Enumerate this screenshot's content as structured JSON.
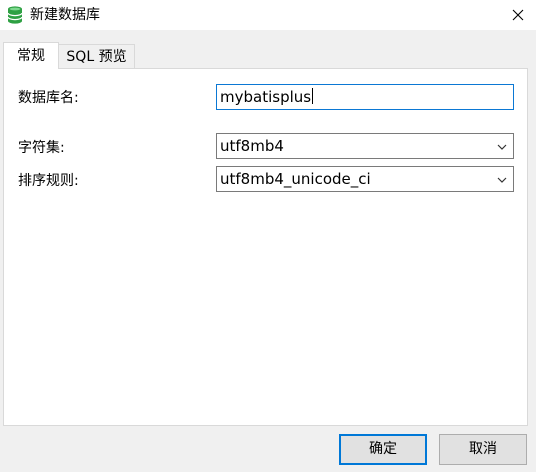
{
  "window": {
    "title": "新建数据库",
    "icon": "database-icon",
    "close_icon": "close-icon"
  },
  "tabs": [
    {
      "label": "常规",
      "active": true
    },
    {
      "label": "SQL 预览",
      "active": false
    }
  ],
  "form": {
    "db_name_label": "数据库名:",
    "db_name_value": "mybatisplus",
    "charset_label": "字符集:",
    "charset_value": "utf8mb4",
    "collation_label": "排序规则:",
    "collation_value": "utf8mb4_unicode_ci"
  },
  "buttons": {
    "ok_label": "确定",
    "cancel_label": "取消"
  },
  "colors": {
    "accent": "#0078d7",
    "db_icon": "#2ea043"
  }
}
